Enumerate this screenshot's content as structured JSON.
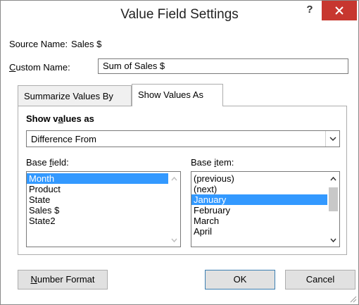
{
  "window": {
    "title": "Value Field Settings",
    "help_label": "?"
  },
  "source": {
    "label": "Source Name:",
    "value": "Sales $"
  },
  "custom_name": {
    "label_underlined": "C",
    "label_rest": "ustom Name:",
    "value": "Sum of Sales $"
  },
  "tabs": [
    {
      "label": "Summarize Values By",
      "active": false
    },
    {
      "label": "Show Values As",
      "active": true
    }
  ],
  "show_values": {
    "heading_pre": "Show v",
    "heading_underlined": "a",
    "heading_post": "lues as",
    "selected": "Difference From"
  },
  "base_field": {
    "label_pre": "Base ",
    "label_underlined": "f",
    "label_post": "ield:",
    "items": [
      "Month",
      "Product",
      "State",
      "Sales $",
      "State2"
    ],
    "selected_index": 0
  },
  "base_item": {
    "label_pre": "Base ",
    "label_underlined": "i",
    "label_post": "tem:",
    "items": [
      "(previous)",
      "(next)",
      "January",
      "February",
      "March",
      "April"
    ],
    "selected_index": 2
  },
  "buttons": {
    "number_format_underlined": "N",
    "number_format_rest": "umber Format",
    "ok": "OK",
    "cancel": "Cancel"
  },
  "colors": {
    "selection": "#3399ff",
    "close": "#c7372f"
  }
}
